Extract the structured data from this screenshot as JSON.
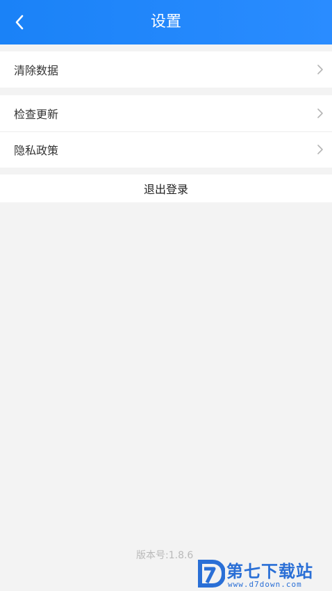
{
  "header": {
    "title": "设置",
    "back_icon": "chevron-left-icon",
    "background": "#1a82f7"
  },
  "groups": [
    {
      "items": [
        {
          "label": "清除数据",
          "icon": "chevron-right-icon"
        }
      ]
    },
    {
      "items": [
        {
          "label": "检查更新",
          "icon": "chevron-right-icon"
        },
        {
          "label": "隐私政策",
          "icon": "chevron-right-icon"
        }
      ]
    }
  ],
  "logout": {
    "label": "退出登录"
  },
  "footer": {
    "version": "版本号:1.8.6"
  },
  "watermark": {
    "brand": "第七下载站",
    "url": "www.d7down.com",
    "color": "#2a6fd6"
  }
}
